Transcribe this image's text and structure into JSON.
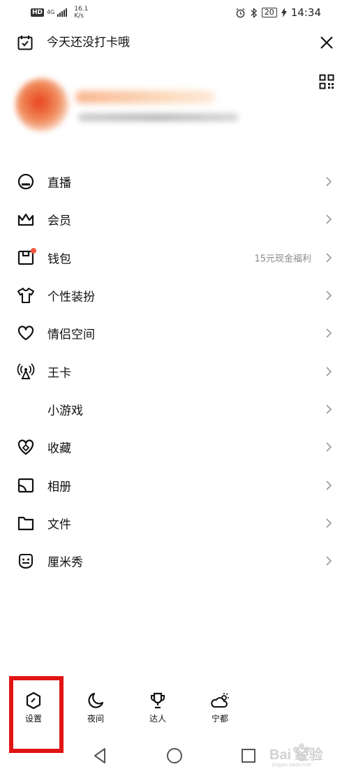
{
  "status_bar": {
    "network_badge": "HD",
    "network_type": "4G",
    "speed_value": "16.1",
    "speed_unit": "K/s",
    "battery": "20",
    "time": "14:34"
  },
  "header": {
    "checkin_text": "今天还没打卡哦"
  },
  "menu": [
    {
      "label": "直播",
      "icon": "live-icon"
    },
    {
      "label": "会员",
      "icon": "crown-icon"
    },
    {
      "label": "钱包",
      "icon": "wallet-icon",
      "note": "15元现金福利",
      "badge_color": "#f2553d"
    },
    {
      "label": "个性装扮",
      "icon": "shirt-icon"
    },
    {
      "label": "情侣空间",
      "icon": "heart-icon"
    },
    {
      "label": "王卡",
      "icon": "signal-tower-icon"
    },
    {
      "label": "小游戏",
      "icon": ""
    },
    {
      "label": "收藏",
      "icon": "favorite-icon"
    },
    {
      "label": "相册",
      "icon": "album-icon"
    },
    {
      "label": "文件",
      "icon": "folder-icon"
    },
    {
      "label": "厘米秀",
      "icon": "cmshow-icon"
    }
  ],
  "shortcuts": [
    {
      "label": "设置",
      "icon": "settings-icon"
    },
    {
      "label": "夜间",
      "icon": "moon-icon"
    },
    {
      "label": "达人",
      "icon": "trophy-icon"
    },
    {
      "label": "宁都",
      "icon": "weather-icon"
    }
  ],
  "watermark": {
    "text": "Bai 经验",
    "sub": "jingyan.baidu.com"
  },
  "colors": {
    "highlight": "#e21414",
    "badge": "#f2553d",
    "note_text": "#8a8a8a"
  }
}
